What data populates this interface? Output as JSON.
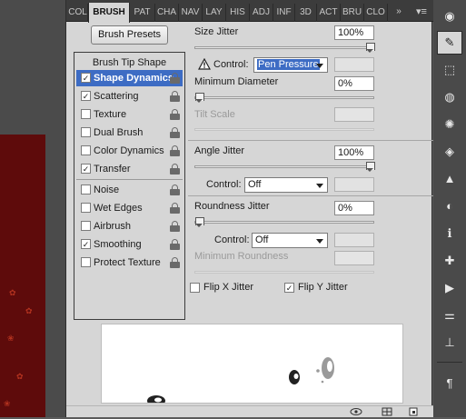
{
  "tabs": [
    "COLOR",
    "BRUSH",
    "PATHS",
    "CHANNELS",
    "NAVIGATOR",
    "LAYERS",
    "HISTOGRAM",
    "ADJUSTMENTS",
    "INFO",
    "3D",
    "ACTIONS",
    "BRUSH PRESETS",
    "CLONE SOURCE"
  ],
  "tab_labels_visible": [
    "COL",
    "BRUSH",
    "PAT",
    "CHA",
    "NAV",
    "LAY",
    "HIS",
    "ADJ",
    "INF",
    "3D",
    "ACT",
    "BRU",
    "CLO"
  ],
  "active_tab": "BRUSH",
  "tab_scroll_icon": "»",
  "panel_menu_icon": "▾≡",
  "brush_presets_button": "Brush Presets",
  "options": {
    "header": "Brush Tip Shape",
    "items": [
      {
        "label": "Shape Dynamics",
        "checked": true,
        "selected": true
      },
      {
        "label": "Scattering",
        "checked": true
      },
      {
        "label": "Texture",
        "checked": false
      },
      {
        "label": "Dual Brush",
        "checked": false
      },
      {
        "label": "Color Dynamics",
        "checked": false
      },
      {
        "label": "Transfer",
        "checked": true
      },
      {
        "label": "Noise",
        "checked": false
      },
      {
        "label": "Wet Edges",
        "checked": false
      },
      {
        "label": "Airbrush",
        "checked": false
      },
      {
        "label": "Smoothing",
        "checked": true
      },
      {
        "label": "Protect Texture",
        "checked": false
      }
    ]
  },
  "controls": {
    "size_jitter_label": "Size Jitter",
    "size_jitter_value": "100%",
    "size_jitter_level": 1.0,
    "control_label": "Control:",
    "size_control_value": "Pen Pressure",
    "min_diameter_label": "Minimum Diameter",
    "min_diameter_value": "0%",
    "min_diameter_level": 0.0,
    "tilt_scale_label": "Tilt Scale",
    "angle_jitter_label": "Angle Jitter",
    "angle_jitter_value": "100%",
    "angle_jitter_level": 1.0,
    "angle_control_value": "Off",
    "roundness_jitter_label": "Roundness Jitter",
    "roundness_jitter_value": "0%",
    "roundness_jitter_level": 0.0,
    "roundness_control_value": "Off",
    "min_roundness_label": "Minimum Roundness",
    "flip_x_label": "Flip X Jitter",
    "flip_x_checked": false,
    "flip_y_label": "Flip Y Jitter",
    "flip_y_checked": true
  },
  "check_mark": "✓",
  "toolbar_icons": [
    "color-swatches-icon",
    "brush-panel-icon",
    "transform-icon",
    "3d-object-icon",
    "3d-mesh-icon",
    "layers-icon",
    "histogram-icon",
    "adjustments-icon",
    "info-icon",
    "actions-icon",
    "play-icon",
    "clone-source-icon",
    "character-icon",
    "paragraph-icon"
  ],
  "toolbar_glyphs": [
    "◉",
    "✎",
    "⬚",
    "◍",
    "✺",
    "◈",
    "▲",
    "◐",
    "ℹ",
    "✚",
    "▶",
    "⚌",
    "⊥",
    "¶"
  ],
  "colors": {
    "selection": "#3d6cc4",
    "panel": "#d6d6d6",
    "canvas": "#5e0b0b"
  }
}
